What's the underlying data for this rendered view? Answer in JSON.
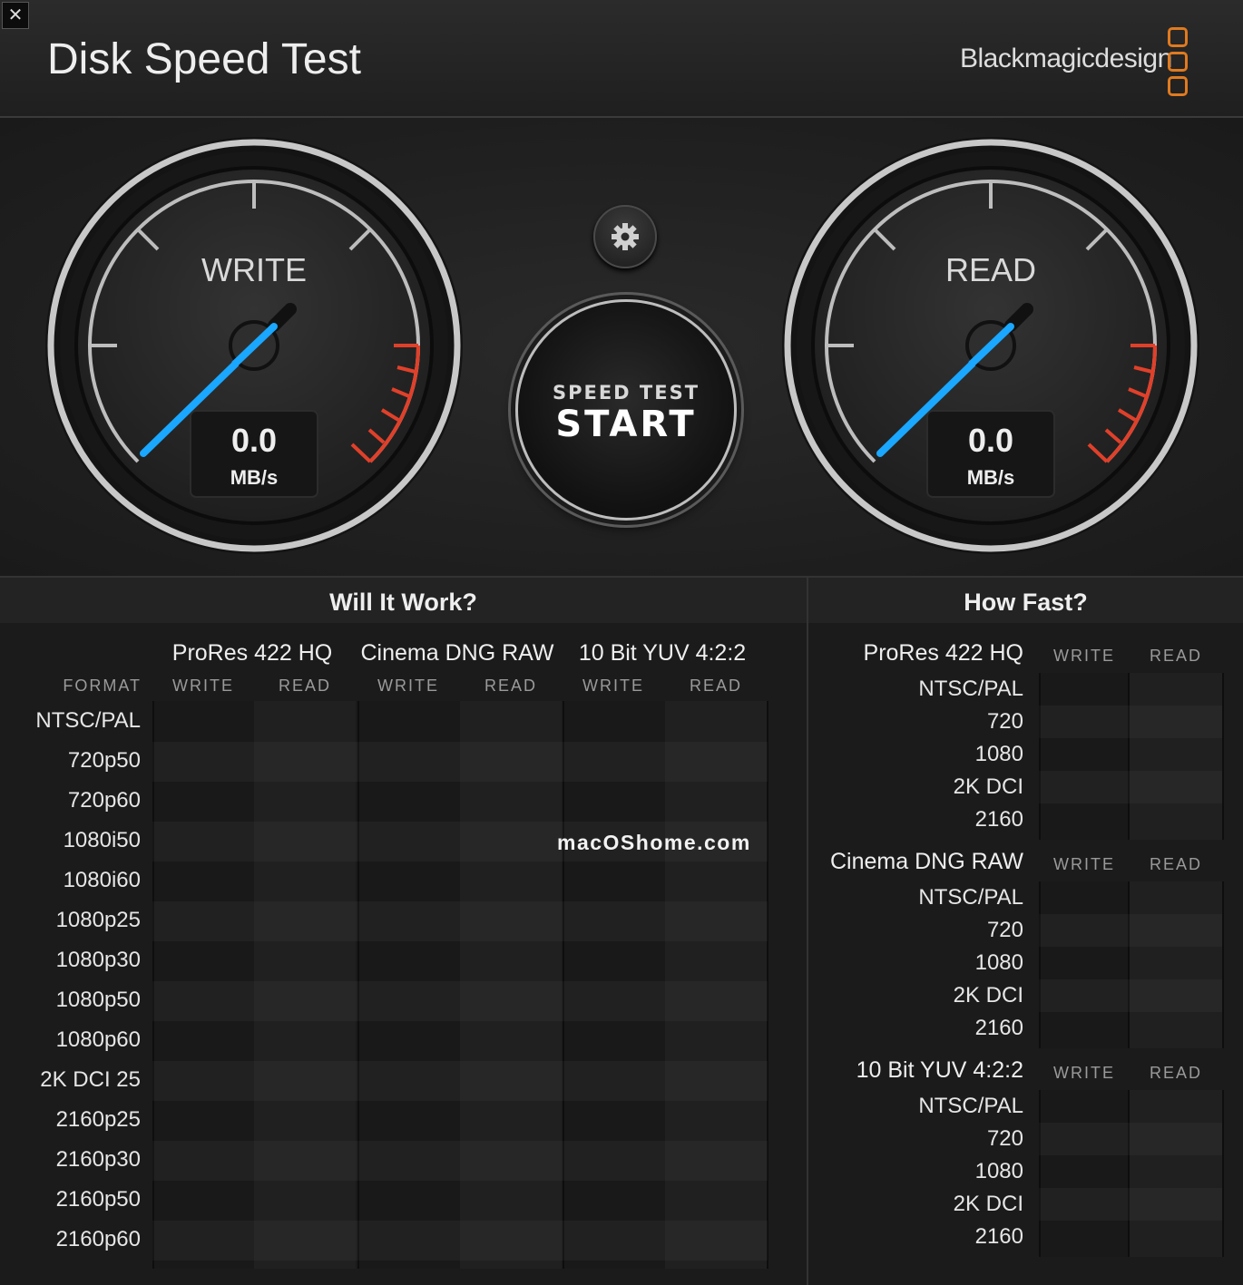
{
  "window": {
    "close_label": "✕",
    "title": "Disk Speed Test",
    "brand": "Blackmagicdesign"
  },
  "colors": {
    "needle": "#1aa7ff",
    "redline": "#e0402a",
    "logo": "#e07a1f"
  },
  "gauges": {
    "write": {
      "label": "WRITE",
      "value": "0.0",
      "unit": "MB/s"
    },
    "read": {
      "label": "READ",
      "value": "0.0",
      "unit": "MB/s"
    }
  },
  "controls": {
    "settings_icon": "gear-icon",
    "start_small": "SPEED TEST",
    "start_big": "START"
  },
  "will_it_work": {
    "title": "Will It Work?",
    "format_label": "FORMAT",
    "groups": [
      {
        "name": "ProRes 422 HQ",
        "write": "WRITE",
        "read": "READ"
      },
      {
        "name": "Cinema DNG RAW",
        "write": "WRITE",
        "read": "READ"
      },
      {
        "name": "10 Bit YUV 4:2:2",
        "write": "WRITE",
        "read": "READ"
      }
    ],
    "rows": [
      "NTSC/PAL",
      "720p50",
      "720p60",
      "1080i50",
      "1080i60",
      "1080p25",
      "1080p30",
      "1080p50",
      "1080p60",
      "2K DCI 25",
      "2160p25",
      "2160p30",
      "2160p50",
      "2160p60"
    ]
  },
  "how_fast": {
    "title": "How Fast?",
    "groups": [
      {
        "name": "ProRes 422 HQ",
        "write": "WRITE",
        "read": "READ",
        "rows": [
          "NTSC/PAL",
          "720",
          "1080",
          "2K DCI",
          "2160"
        ]
      },
      {
        "name": "Cinema DNG RAW",
        "write": "WRITE",
        "read": "READ",
        "rows": [
          "NTSC/PAL",
          "720",
          "1080",
          "2K DCI",
          "2160"
        ]
      },
      {
        "name": "10 Bit YUV 4:2:2",
        "write": "WRITE",
        "read": "READ",
        "rows": [
          "NTSC/PAL",
          "720",
          "1080",
          "2K DCI",
          "2160"
        ]
      }
    ]
  },
  "overlay": {
    "watermark": "macOShome.com"
  }
}
